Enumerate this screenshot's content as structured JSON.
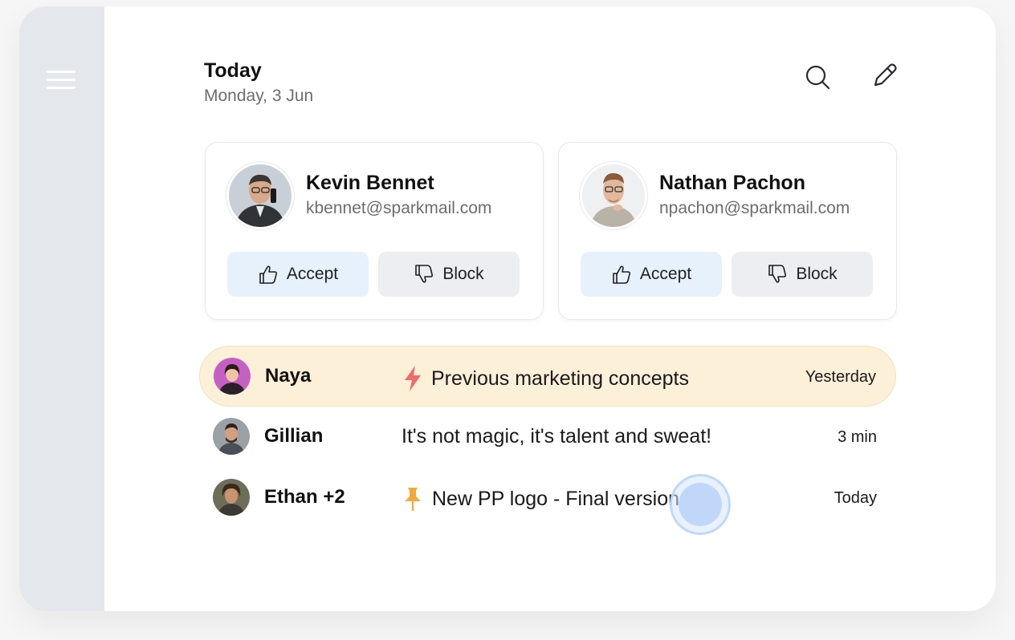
{
  "header": {
    "title": "Today",
    "date": "Monday, 3 Jun"
  },
  "icons": {
    "menu": "hamburger-icon",
    "search": "search-icon",
    "compose": "pencil-icon"
  },
  "requests": [
    {
      "name": "Kevin Bennet",
      "email": "kbennet@sparkmail.com",
      "accept_label": "Accept",
      "block_label": "Block"
    },
    {
      "name": "Nathan Pachon",
      "email": "npachon@sparkmail.com",
      "accept_label": "Accept",
      "block_label": "Block"
    }
  ],
  "messages": [
    {
      "sender": "Naya",
      "subject": "Previous marketing concepts",
      "time": "Yesterday",
      "icon": "lightning-icon",
      "highlighted": true
    },
    {
      "sender": "Gillian",
      "subject": "It's not magic, it's talent and sweat!",
      "time": "3 min",
      "icon": null,
      "highlighted": false
    },
    {
      "sender": "Ethan +2",
      "subject": "New PP logo - Final version",
      "time": "Today",
      "icon": "pin-icon",
      "highlighted": false
    }
  ],
  "colors": {
    "sidebar": "#e4e7ec",
    "accept_bg": "#e6f1fc",
    "block_bg": "#eceef1",
    "highlight_row": "#fdf0d8",
    "lightning": "#f06b6b",
    "pin": "#f4a83a"
  }
}
